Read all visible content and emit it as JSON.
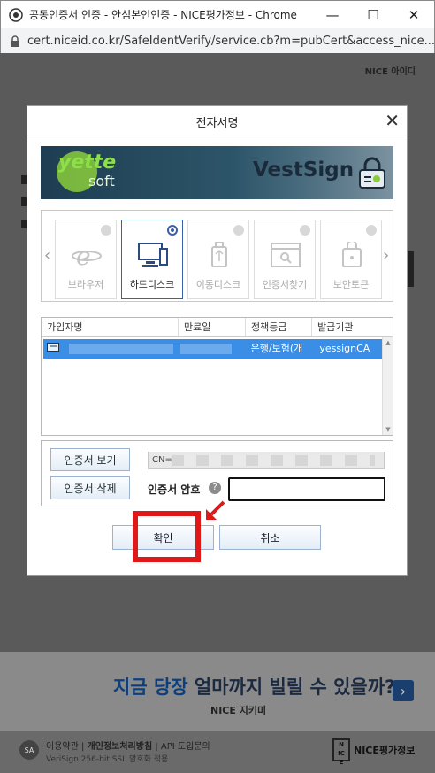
{
  "window": {
    "title": "공동인증서 인증 - 안심본인인증 - NICE평가정보 - Chrome",
    "url": "cert.niceid.co.kr/SafeIdentVerify/service.cb?m=pubCert&access_nice..."
  },
  "page": {
    "nice_logo": "NICE 아이디",
    "banner": {
      "headline_hi": "지금 당장",
      "headline_mid": "얼마까지",
      "headline_rest": "빌릴 수 있을까?",
      "sub": "NICE 지키미"
    },
    "footer": {
      "line1_a": "이용약관",
      "line1_b": "개인정보처리방침",
      "line1_c": "API 도입문의",
      "line2": "VeriSign 256-bit SSL 암호화 적용",
      "badge": "SA",
      "brand": "NICE평가정보"
    }
  },
  "dialog": {
    "title": "전자서명",
    "brand_left_top": "yette",
    "brand_left_bottom": "soft",
    "brand_right": "VestSign",
    "storage_items": [
      {
        "label": "브라우저",
        "icon": "browser-icon",
        "selected": false
      },
      {
        "label": "하드디스크",
        "icon": "harddisk-icon",
        "selected": true
      },
      {
        "label": "이동디스크",
        "icon": "usb-icon",
        "selected": false
      },
      {
        "label": "인증서찾기",
        "icon": "cert-search-icon",
        "selected": false
      },
      {
        "label": "보안토큰",
        "icon": "security-token-icon",
        "selected": false
      }
    ],
    "cert_table": {
      "headers": [
        "가입자명",
        "만료일",
        "정책등급",
        "발급기관"
      ],
      "rows": [
        {
          "name": "",
          "expiry": "",
          "policy": "은행/보험(개",
          "issuer": "yessignCA"
        }
      ]
    },
    "buttons": {
      "view_cert": "인증서 보기",
      "delete_cert": "인증서 삭제",
      "confirm": "확인",
      "cancel": "취소"
    },
    "cn_prefix": "CN=",
    "password_label": "인증서 암호",
    "help": "?",
    "colors": {
      "highlight": "#e01818",
      "selection": "#3a8ee6"
    }
  }
}
